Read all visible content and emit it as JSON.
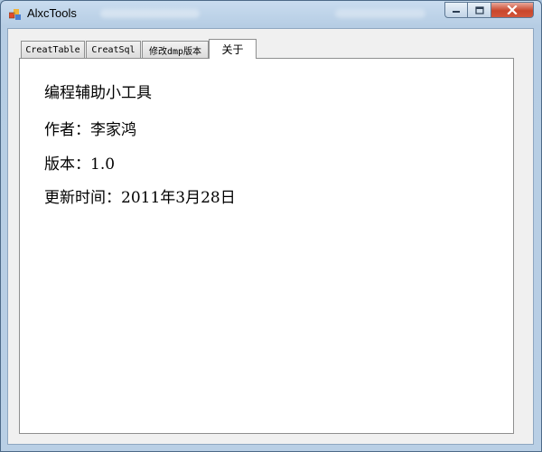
{
  "window": {
    "title": "AlxcTools",
    "controls": {
      "minimize": "minimize-icon",
      "maximize": "maximize-icon",
      "close": "close-icon"
    }
  },
  "tabs": [
    {
      "label": "CreatTable",
      "selected": false
    },
    {
      "label": "CreatSql",
      "selected": false
    },
    {
      "label": "修改dmp版本",
      "selected": false
    },
    {
      "label": "关于",
      "selected": true
    }
  ],
  "about": {
    "app_name": "编程辅助小工具",
    "author": "作者：李家鸿",
    "version": "版本：1.0",
    "updated": "更新时间：2011年3月28日"
  },
  "colors": {
    "title_bar": "#c9dcef",
    "close_button": "#c9462c",
    "panel_background": "#ffffff",
    "form_background": "#f0f0f0"
  }
}
